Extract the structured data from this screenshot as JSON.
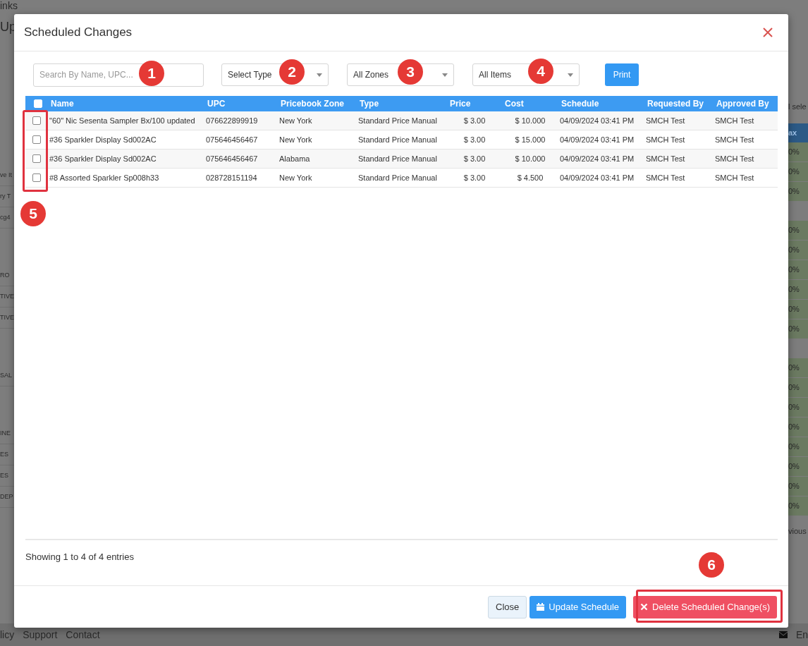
{
  "background": {
    "top_text": "inks",
    "heading": "Up",
    "left_groups": [
      [
        "ve It",
        "ry T",
        "cg4"
      ],
      [
        "RO",
        "TIVE",
        "TIVE"
      ],
      [
        "SAL"
      ],
      [
        "INE",
        "ES",
        "ES",
        "DEP"
      ]
    ],
    "right_header": "l sele",
    "right_column_title": "ax",
    "right_groups": [
      [
        "0%",
        "0%",
        "0%"
      ],
      [
        "0%",
        "0%",
        "0%",
        "0%",
        "0%",
        "0%"
      ],
      [
        "0%",
        "0%",
        "0%",
        "0%",
        "0%",
        "0%",
        "0%",
        "0%"
      ]
    ],
    "pager_text": "vious",
    "footer_links": [
      "licy",
      "Support",
      "Contact"
    ],
    "footer_right": "En"
  },
  "modal": {
    "title": "Scheduled Changes",
    "filters": {
      "search": {
        "placeholder": "Search By Name, UPC..."
      },
      "selects": [
        "Select Type",
        "All Zones",
        "All Items"
      ],
      "print_button": "Print"
    },
    "table": {
      "select_all": {
        "checked": false
      },
      "columns": [
        "Name",
        "UPC",
        "Pricebook Zone",
        "Type",
        "Price",
        "Cost",
        "Schedule",
        "Requested By",
        "Approved By"
      ],
      "rows": [
        {
          "checked": false,
          "cells": [
            "\"60\" Nic Sesenta Sampler Bx/100 updated",
            "076622899919",
            "New York",
            "Standard Price Manual",
            "$ 3.00",
            "$ 10.000",
            "04/09/2024 03:41 PM",
            "SMCH Test",
            "SMCH Test"
          ]
        },
        {
          "checked": false,
          "cells": [
            "#36 Sparkler Display Sd002AC",
            "075646456467",
            "New York",
            "Standard Price Manual",
            "$ 3.00",
            "$ 15.000",
            "04/09/2024 03:41 PM",
            "SMCH Test",
            "SMCH Test"
          ]
        },
        {
          "checked": false,
          "cells": [
            "#36 Sparkler Display Sd002AC",
            "075646456467",
            "Alabama",
            "Standard Price Manual",
            "$ 3.00",
            "$ 10.000",
            "04/09/2024 03:41 PM",
            "SMCH Test",
            "SMCH Test"
          ]
        },
        {
          "checked": false,
          "cells": [
            "#8 Assorted Sparkler Sp008h33",
            "028728151194",
            "New York",
            "Standard Price Manual",
            "$ 3.00",
            "$ 4.500",
            "04/09/2024 03:41 PM",
            "SMCH Test",
            "SMCH Test"
          ]
        }
      ]
    },
    "entries_info": "Showing 1 to 4 of 4 entries",
    "buttons": [
      {
        "kind": "plain",
        "label": "Close"
      },
      {
        "kind": "primary",
        "label": "Update Schedule"
      },
      {
        "kind": "danger",
        "label": "Delete Scheduled Change(s)"
      }
    ]
  },
  "annotations": [
    {
      "number": "1"
    },
    {
      "number": "2"
    },
    {
      "number": "3"
    },
    {
      "number": "4"
    },
    {
      "number": "5"
    },
    {
      "number": "6"
    }
  ]
}
